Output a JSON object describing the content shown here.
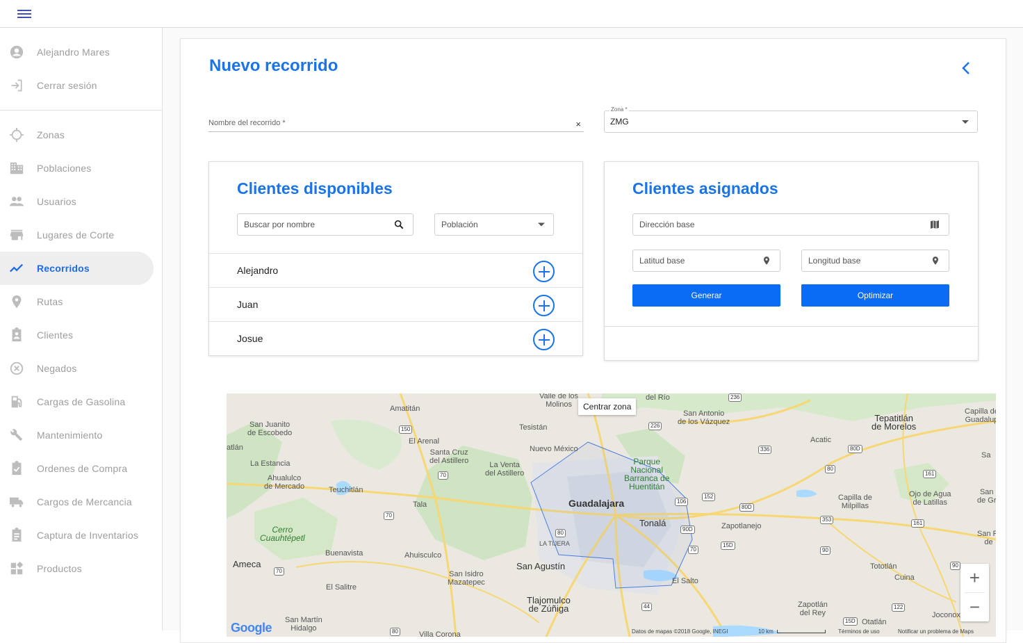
{
  "sidebar": {
    "user": {
      "name": "Alejandro Mares",
      "logout": "Cerrar sesión"
    },
    "items": [
      {
        "label": "Zonas",
        "icon": "crosshair-icon"
      },
      {
        "label": "Poblaciones",
        "icon": "building-icon"
      },
      {
        "label": "Usuarios",
        "icon": "people-icon"
      },
      {
        "label": "Lugares de Corte",
        "icon": "store-icon"
      },
      {
        "label": "Recorridos",
        "icon": "trending-icon",
        "active": true
      },
      {
        "label": "Rutas",
        "icon": "location-pin-icon"
      },
      {
        "label": "Clientes",
        "icon": "clipboard-person-icon"
      },
      {
        "label": "Negados",
        "icon": "cancel-circle-icon"
      },
      {
        "label": "Cargas de Gasolina",
        "icon": "gas-station-icon"
      },
      {
        "label": "Mantenimiento",
        "icon": "wrench-icon"
      },
      {
        "label": "Ordenes de Compra",
        "icon": "clipboard-check-icon"
      },
      {
        "label": "Cargos de Mercancia",
        "icon": "truck-icon"
      },
      {
        "label": "Captura de Inventarios",
        "icon": "clipboard-list-icon"
      },
      {
        "label": "Productos",
        "icon": "widgets-icon"
      }
    ]
  },
  "page": {
    "title": "Nuevo recorrido",
    "route_name_label": "Nombre del recorrido *",
    "route_name_value": "",
    "zone_label": "Zona *",
    "zone_value": "ZMG"
  },
  "available": {
    "title": "Clientes disponibles",
    "search_placeholder": "Buscar por nombre",
    "population_placeholder": "Población",
    "clients": [
      "Alejandro",
      "Juan",
      "Josue"
    ]
  },
  "assigned": {
    "title": "Clientes asignados",
    "base_address_placeholder": "Dirección base",
    "base_lat_placeholder": "Latitud base",
    "base_lng_placeholder": "Longitud base",
    "generate_label": "Generar",
    "optimize_label": "Optimizar"
  },
  "map": {
    "center_zone_label": "Centrar zona",
    "zoom_in": "+",
    "zoom_out": "−",
    "google_logo": "Google",
    "attribution": "Datos de mapas ©2018 Google, INEGI",
    "scale": "10 km",
    "terms": "Términos de uso",
    "report": "Notificar un problema de Maps",
    "labels": {
      "guadalajara": "Guadalajara",
      "tonala": "Tonalá",
      "san_agustin": "San Agustín",
      "tlajomulco": "Tlajomulco\nde Zúñiga",
      "la_tijera": "LA TIJERA",
      "el_salto": "El Salto",
      "zapotlanejo": "Zapotlanejo",
      "tepatitlan": "Tepatitlán\nde Morelos",
      "amatitan": "Amatitán",
      "tesistan": "Tesistán",
      "nuevo_mexico": "Nuevo México",
      "el_arenal": "El Arenal",
      "santa_cruz": "Santa Cruz\ndel Astillero",
      "la_venta": "La Venta\ndel Astillero",
      "san_juanito": "San Juanito\nde Escobedo",
      "la_estancia": "La Estancia",
      "ahualulco": "Ahualulco\nde Mercado",
      "teuchitlan": "Teuchitlán",
      "tala": "Tala",
      "cerro": "Cerro\nCuauhtépetl",
      "buenavista": "Buenavista",
      "ahuisculco": "Ahuisculco",
      "ameca": "Ameca",
      "san_isidro": "San Isidro\nMazatepec",
      "el_salitre": "El Salitre",
      "san_martin": "San Martín\nHidalgo",
      "villa_corona": "Villa Corona",
      "parque": "Parque\nNacional\nBarranca de\nHuentitán",
      "san_antonio": "San Antonio\nde los Vázquez",
      "acatic": "Acatic",
      "capilla_milpillas": "Capilla de\nMilpillas",
      "ojo_agua": "Ojo de Agua\nde Latillas",
      "totolan": "Tototlán",
      "cuina": "Cuina",
      "zapotlan_rey": "Zapotlán\ndel Rey",
      "otatlan": "Otatlán",
      "joconoxtle": "Joconoxtle",
      "valle_molinos": "Valle de los\nMolinos",
      "del_rio": "del Río",
      "atlan": "atlán",
      "capilla_guad": "Capilla de\nGuadalup",
      "san_r": "San\nde Gr",
      "san_fr": "San Fr\nde",
      "sa": "Sa"
    }
  }
}
